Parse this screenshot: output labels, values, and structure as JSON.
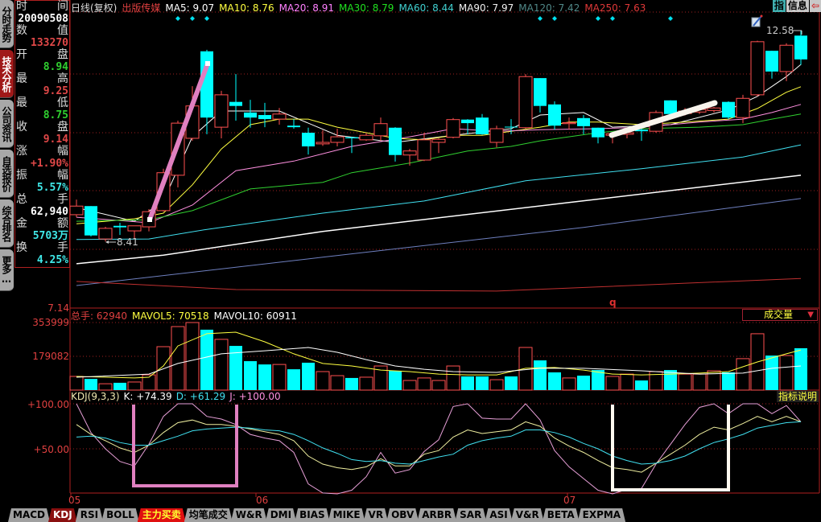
{
  "side_tabs": [
    "分时走势",
    "技术分析",
    "公司资讯",
    "自选报价",
    "综合排名",
    "更多…"
  ],
  "active_side_tab": 1,
  "info_panel": [
    {
      "l1": "时",
      "l2": "间",
      "value": "20090508",
      "color": "#ffffff"
    },
    {
      "l1": "数",
      "l2": "值",
      "value": "133270",
      "color": "#e04848"
    },
    {
      "l1": "开",
      "l2": "盘",
      "value": "8.94",
      "color": "#30d030"
    },
    {
      "l1": "最",
      "l2": "高",
      "value": "9.25",
      "color": "#e04848"
    },
    {
      "l1": "最",
      "l2": "低",
      "value": "8.75",
      "color": "#30d030"
    },
    {
      "l1": "收",
      "l2": "盘",
      "value": "9.14",
      "color": "#e04848"
    },
    {
      "l1": "涨",
      "l2": "幅",
      "value": "+1.90%",
      "color": "#e04848"
    },
    {
      "l1": "振",
      "l2": "幅",
      "value": "5.57%",
      "color": "#40e8e8"
    },
    {
      "l1": "总",
      "l2": "手",
      "value": "62,940",
      "color": "#ffffff"
    },
    {
      "l1": "金",
      "l2": "额",
      "value": "5703万",
      "color": "#40e8e8"
    },
    {
      "l1": "换",
      "l2": "手",
      "value": "4.25%",
      "color": "#40e8e8"
    }
  ],
  "header": {
    "period": "日线(复权)",
    "stock_name": "出版传媒",
    "ma_labels": [
      {
        "text": "MA5: 9.07",
        "color": "#ffffff"
      },
      {
        "text": "MA10: 8.76",
        "color": "#ffff40"
      },
      {
        "text": "MA20: 8.91",
        "color": "#ff80ff"
      },
      {
        "text": "MA30: 8.79",
        "color": "#20e020"
      },
      {
        "text": "MA60: 8.44",
        "color": "#40d0d0"
      },
      {
        "text": "MA90: 7.97",
        "color": "#f0f0f0"
      },
      {
        "text": "MA120: 7.42",
        "color": "#508888"
      },
      {
        "text": "MA250: 7.63",
        "color": "#e03838"
      }
    ]
  },
  "top_buttons": {
    "indicator": "指",
    "info": "信息",
    "exit_icon": "exit-icon"
  },
  "axis": {
    "price_min": "7.14",
    "vol_max": "353999",
    "vol_mid": "179082",
    "kdj_100": "+100.00",
    "kdj_50": "+50.00",
    "x_labels": [
      "05",
      "06",
      "07"
    ]
  },
  "price_tags": {
    "high": "12.58",
    "low": "8.41"
  },
  "marker_letter": "q",
  "volume_header": {
    "total": "总手: 62940",
    "mavol5": "MAVOL5: 70518",
    "mavol10": "MAVOL10: 60911",
    "dropdown": "成交量",
    "dropdown_arrow": "▼"
  },
  "kdj_header": {
    "name": "KDJ(9,3,3)",
    "k": "K: +74.39",
    "d": "D: +61.29",
    "j": "J: +100.00",
    "help": "指标说明"
  },
  "bottom_tabs": [
    "MACD",
    "KDJ",
    "RSI",
    "BOLL",
    "主力买卖",
    "均笔成交",
    "W&R",
    "DMI",
    "BIAS",
    "MIKE",
    "VR",
    "OBV",
    "ARBR",
    "SAR",
    "ASI",
    "V&R",
    "BETA",
    "EXPMA"
  ],
  "active_bottom_tab": 1,
  "hot_bottom_tab": 4,
  "colors": {
    "up": "#ff5050",
    "down": "#00ffff",
    "grid": "#a02020"
  },
  "chart_data": {
    "type": "candlestick",
    "price_range": [
      7.14,
      12.71
    ],
    "candles_ohlc": [
      [
        8.94,
        9.24,
        8.89,
        9.11
      ],
      [
        9.11,
        9.11,
        8.51,
        8.53
      ],
      [
        8.46,
        8.7,
        8.41,
        8.67
      ],
      [
        8.72,
        8.78,
        8.54,
        8.69
      ],
      [
        8.62,
        8.72,
        8.46,
        8.72
      ],
      [
        8.7,
        9.05,
        8.61,
        9.0
      ],
      [
        9.02,
        9.85,
        9.0,
        9.77
      ],
      [
        9.72,
        10.8,
        9.48,
        10.75
      ],
      [
        10.45,
        11.48,
        10.4,
        11.09
      ],
      [
        12.17,
        12.2,
        10.53,
        10.86
      ],
      [
        10.67,
        11.39,
        10.45,
        11.31
      ],
      [
        11.17,
        11.72,
        10.8,
        11.09
      ],
      [
        10.96,
        11.21,
        10.66,
        10.86
      ],
      [
        10.91,
        11.15,
        10.67,
        10.83
      ],
      [
        10.83,
        11.05,
        10.72,
        10.93
      ],
      [
        10.7,
        10.83,
        10.64,
        10.67
      ],
      [
        10.56,
        10.66,
        10.13,
        10.29
      ],
      [
        10.34,
        10.61,
        10.3,
        10.37
      ],
      [
        10.37,
        10.64,
        10.29,
        10.48
      ],
      [
        10.47,
        10.48,
        10.16,
        10.45
      ],
      [
        10.42,
        10.56,
        10.4,
        10.51
      ],
      [
        10.5,
        10.86,
        10.4,
        10.74
      ],
      [
        10.66,
        10.67,
        9.99,
        10.12
      ],
      [
        10.12,
        10.24,
        9.91,
        10.2
      ],
      [
        10.02,
        10.56,
        10.0,
        10.42
      ],
      [
        10.37,
        10.45,
        10.16,
        10.43
      ],
      [
        10.47,
        10.85,
        10.45,
        10.82
      ],
      [
        10.82,
        10.83,
        10.53,
        10.75
      ],
      [
        10.86,
        10.93,
        10.52,
        10.53
      ],
      [
        10.37,
        10.7,
        10.27,
        10.64
      ],
      [
        10.68,
        10.83,
        10.53,
        10.67
      ],
      [
        10.66,
        11.72,
        10.64,
        11.67
      ],
      [
        11.64,
        11.64,
        10.96,
        11.09
      ],
      [
        11.12,
        11.18,
        10.62,
        10.7
      ],
      [
        10.74,
        10.86,
        10.62,
        10.76
      ],
      [
        10.85,
        10.91,
        10.53,
        10.69
      ],
      [
        10.66,
        10.66,
        10.35,
        10.47
      ],
      [
        10.51,
        10.56,
        10.35,
        10.54
      ],
      [
        10.53,
        10.62,
        10.45,
        10.56
      ],
      [
        10.62,
        10.64,
        10.4,
        10.59
      ],
      [
        10.59,
        11.0,
        10.56,
        10.96
      ],
      [
        11.2,
        11.2,
        10.9,
        10.93
      ],
      [
        10.94,
        11.05,
        10.9,
        10.99
      ],
      [
        10.97,
        11.05,
        10.93,
        11.02
      ],
      [
        11.0,
        11.07,
        10.96,
        11.05
      ],
      [
        11.17,
        11.18,
        10.83,
        10.86
      ],
      [
        10.86,
        11.31,
        10.75,
        11.24
      ],
      [
        11.31,
        12.38,
        11.28,
        12.36
      ],
      [
        12.18,
        12.18,
        11.63,
        11.77
      ],
      [
        11.77,
        12.33,
        11.58,
        12.29
      ],
      [
        12.48,
        12.58,
        11.9,
        12.01
      ]
    ],
    "moving_averages": [
      {
        "name": "MA5",
        "color": "#ffffff",
        "points": [
          [
            1,
            9.08
          ],
          [
            5,
            8.81
          ],
          [
            7,
            9.21
          ],
          [
            9,
            10.48
          ],
          [
            11,
            10.99
          ],
          [
            15,
            10.99
          ],
          [
            19,
            10.51
          ],
          [
            23,
            10.37
          ],
          [
            27,
            10.51
          ],
          [
            31,
            10.64
          ],
          [
            33,
            10.91
          ],
          [
            36,
            10.96
          ],
          [
            38,
            10.67
          ],
          [
            42,
            10.72
          ],
          [
            46,
            11.01
          ],
          [
            48,
            11.28
          ],
          [
            50,
            11.67
          ],
          [
            51,
            11.91
          ]
        ]
      },
      {
        "name": "MA10",
        "color": "#ffff40",
        "points": [
          [
            1,
            8.76
          ],
          [
            5,
            8.86
          ],
          [
            7,
            8.97
          ],
          [
            9,
            9.53
          ],
          [
            11,
            10.24
          ],
          [
            13,
            10.72
          ],
          [
            15,
            10.83
          ],
          [
            17,
            10.83
          ],
          [
            19,
            10.67
          ],
          [
            21,
            10.56
          ],
          [
            23,
            10.45
          ],
          [
            25,
            10.42
          ],
          [
            27,
            10.51
          ],
          [
            29,
            10.51
          ],
          [
            31,
            10.59
          ],
          [
            33,
            10.67
          ],
          [
            35,
            10.77
          ],
          [
            37,
            10.77
          ],
          [
            40,
            10.72
          ],
          [
            43,
            10.77
          ],
          [
            46,
            10.83
          ],
          [
            48,
            11.04
          ],
          [
            50,
            11.36
          ],
          [
            51,
            11.47
          ]
        ]
      },
      {
        "name": "MA20",
        "color": "#ff90e0",
        "points": [
          [
            1,
            8.89
          ],
          [
            6,
            8.78
          ],
          [
            9,
            9.13
          ],
          [
            12,
            9.81
          ],
          [
            16,
            10.0
          ],
          [
            20,
            10.29
          ],
          [
            24,
            10.48
          ],
          [
            27,
            10.64
          ],
          [
            30,
            10.59
          ],
          [
            33,
            10.62
          ],
          [
            37,
            10.64
          ],
          [
            40,
            10.67
          ],
          [
            44,
            10.77
          ],
          [
            47,
            10.83
          ],
          [
            49,
            10.96
          ],
          [
            51,
            11.12
          ]
        ]
      },
      {
        "name": "MA30",
        "color": "#30d030",
        "points": [
          [
            1,
            8.81
          ],
          [
            6,
            8.84
          ],
          [
            9,
            9.02
          ],
          [
            13,
            9.45
          ],
          [
            18,
            9.58
          ],
          [
            20,
            9.77
          ],
          [
            24,
            9.96
          ],
          [
            28,
            10.2
          ],
          [
            31,
            10.29
          ],
          [
            33,
            10.4
          ],
          [
            37,
            10.56
          ],
          [
            40,
            10.64
          ],
          [
            44,
            10.67
          ],
          [
            47,
            10.72
          ],
          [
            49,
            10.83
          ],
          [
            51,
            10.93
          ]
        ]
      },
      {
        "name": "MA60",
        "color": "#40e0f0",
        "points": [
          [
            1,
            8.45
          ],
          [
            6,
            8.46
          ],
          [
            10,
            8.65
          ],
          [
            18,
            8.97
          ],
          [
            25,
            9.21
          ],
          [
            32,
            9.61
          ],
          [
            40,
            9.85
          ],
          [
            47,
            10.08
          ],
          [
            51,
            10.32
          ]
        ]
      },
      {
        "name": "MA90",
        "color": "#ffffff",
        "points": [
          [
            1,
            7.97
          ],
          [
            7,
            8.14
          ],
          [
            18,
            8.61
          ],
          [
            35,
            9.18
          ],
          [
            51,
            9.72
          ]
        ]
      },
      {
        "name": "MA120",
        "color": "#6f80c0",
        "points": [
          [
            1,
            7.54
          ],
          [
            18,
            8.1
          ],
          [
            36,
            8.69
          ],
          [
            51,
            9.26
          ]
        ]
      },
      {
        "name": "MA250",
        "color": "#c03030",
        "points": [
          [
            1,
            7.62
          ],
          [
            12,
            7.46
          ],
          [
            30,
            7.43
          ],
          [
            51,
            7.68
          ]
        ]
      }
    ],
    "signal_indices": [
      8,
      9,
      10,
      33,
      34,
      37,
      38,
      42
    ],
    "volume": {
      "ylim": [
        0,
        353999
      ],
      "values": [
        75000,
        62000,
        37000,
        42000,
        46000,
        83000,
        229000,
        333000,
        354000,
        317000,
        267000,
        233000,
        154000,
        137000,
        137000,
        112000,
        146000,
        100000,
        79000,
        67000,
        71000,
        129000,
        104000,
        54000,
        67000,
        54000,
        129000,
        75000,
        75000,
        58000,
        75000,
        225000,
        158000,
        96000,
        67000,
        79000,
        108000,
        75000,
        87000,
        54000,
        100000,
        108000,
        87000,
        87000,
        104000,
        96000,
        167000,
        296000,
        183000,
        183000,
        221000
      ],
      "mavol5": [
        [
          1,
          75000
        ],
        [
          5,
          67000
        ],
        [
          6,
          71000
        ],
        [
          7,
          129000
        ],
        [
          8,
          233000
        ],
        [
          10,
          296000
        ],
        [
          12,
          304000
        ],
        [
          14,
          254000
        ],
        [
          16,
          192000
        ],
        [
          18,
          142000
        ],
        [
          20,
          129000
        ],
        [
          22,
          108000
        ],
        [
          24,
          100000
        ],
        [
          26,
          87000
        ],
        [
          28,
          83000
        ],
        [
          30,
          83000
        ],
        [
          32,
          117000
        ],
        [
          34,
          121000
        ],
        [
          36,
          108000
        ],
        [
          38,
          87000
        ],
        [
          40,
          83000
        ],
        [
          42,
          87000
        ],
        [
          44,
          92000
        ],
        [
          46,
          100000
        ],
        [
          48,
          150000
        ],
        [
          50,
          192000
        ],
        [
          51,
          212000
        ]
      ],
      "mavol10": [
        [
          1,
          71000
        ],
        [
          6,
          87000
        ],
        [
          8,
          142000
        ],
        [
          11,
          192000
        ],
        [
          14,
          208000
        ],
        [
          17,
          225000
        ],
        [
          19,
          200000
        ],
        [
          21,
          162000
        ],
        [
          23,
          129000
        ],
        [
          25,
          112000
        ],
        [
          27,
          100000
        ],
        [
          30,
          96000
        ],
        [
          33,
          117000
        ],
        [
          36,
          117000
        ],
        [
          40,
          104000
        ],
        [
          44,
          87000
        ],
        [
          47,
          92000
        ],
        [
          49,
          117000
        ],
        [
          51,
          129000
        ]
      ]
    },
    "kdj": {
      "ylim": [
        0,
        100
      ],
      "K": [
        77,
        66,
        59,
        51,
        46,
        54,
        68,
        79,
        82,
        77,
        77,
        75,
        72,
        69,
        66,
        59,
        42,
        33,
        29,
        27,
        30,
        39,
        31,
        31,
        44,
        48,
        63,
        71,
        67,
        69,
        71,
        80,
        75,
        62,
        53,
        46,
        37,
        29,
        27,
        24,
        34,
        44,
        54,
        66,
        74,
        71,
        78,
        86,
        80,
        86,
        80
      ],
      "D": [
        63,
        64,
        62,
        57,
        54,
        54,
        59,
        64,
        70,
        72,
        73,
        74,
        73,
        71,
        70,
        66,
        59,
        51,
        45,
        38,
        36,
        37,
        34,
        33,
        37,
        41,
        44,
        54,
        59,
        62,
        64,
        71,
        71,
        68,
        63,
        56,
        50,
        42,
        37,
        33,
        34,
        37,
        42,
        50,
        57,
        61,
        66,
        73,
        76,
        79,
        80
      ],
      "J": [
        102,
        68,
        50,
        36,
        31,
        55,
        86,
        100,
        100,
        86,
        83,
        77,
        66,
        62,
        59,
        46,
        11,
        1,
        0,
        4,
        19,
        46,
        23,
        27,
        47,
        60,
        97,
        100,
        84,
        83,
        83,
        100,
        82,
        48,
        30,
        17,
        4,
        0,
        5,
        6,
        33,
        55,
        77,
        96,
        100,
        89,
        100,
        100,
        89,
        98,
        80
      ]
    }
  }
}
